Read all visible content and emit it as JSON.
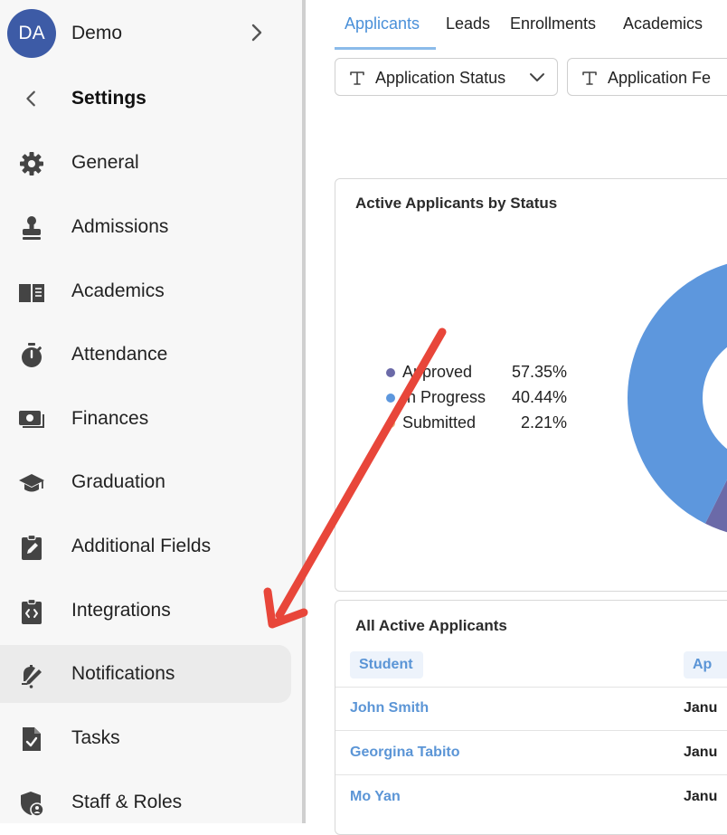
{
  "sidebar": {
    "user": {
      "initials": "DA",
      "name": "Demo"
    },
    "back_title": "Settings",
    "items": [
      {
        "label": "General",
        "icon": "gear-icon"
      },
      {
        "label": "Admissions",
        "icon": "stamp-icon"
      },
      {
        "label": "Academics",
        "icon": "book-icon"
      },
      {
        "label": "Attendance",
        "icon": "stopwatch-icon"
      },
      {
        "label": "Finances",
        "icon": "money-icon"
      },
      {
        "label": "Graduation",
        "icon": "graduation-cap-icon"
      },
      {
        "label": "Additional Fields",
        "icon": "clipboard-edit-icon"
      },
      {
        "label": "Integrations",
        "icon": "clipboard-code-icon"
      },
      {
        "label": "Notifications",
        "icon": "bell-edit-icon"
      },
      {
        "label": "Tasks",
        "icon": "file-check-icon"
      },
      {
        "label": "Staff & Roles",
        "icon": "shield-user-icon"
      }
    ],
    "active_item": "Notifications"
  },
  "main": {
    "tabs": [
      {
        "label": "Applicants",
        "active": true
      },
      {
        "label": "Leads",
        "active": false
      },
      {
        "label": "Enrollments",
        "active": false
      },
      {
        "label": "Academics",
        "active": false
      }
    ],
    "filters": [
      {
        "label": "Application Status"
      },
      {
        "label": "Application Fe"
      }
    ],
    "status_card": {
      "title": "Active Applicants by Status"
    },
    "applicants_table": {
      "title": "All Active Applicants",
      "headers": [
        "Student",
        "Ap"
      ],
      "rows": [
        {
          "student": "John Smith",
          "date": "Janu"
        },
        {
          "student": "Georgina Tabito",
          "date": "Janu"
        },
        {
          "student": "Mo Yan",
          "date": "Janu"
        }
      ]
    }
  },
  "colors": {
    "accent": "#4a90d9",
    "approved": "#6b6aa8",
    "in_progress": "#5d97dd",
    "submitted": "#f0b27a",
    "annotation_arrow": "#e8463a"
  },
  "chart_data": {
    "type": "pie",
    "title": "Active Applicants by Status",
    "categories": [
      "Approved",
      "In Progress",
      "Submitted"
    ],
    "values": [
      57.35,
      40.44,
      2.21
    ],
    "value_labels": [
      "57.35%",
      "40.44%",
      "2.21%"
    ],
    "legend_placement": "left"
  }
}
